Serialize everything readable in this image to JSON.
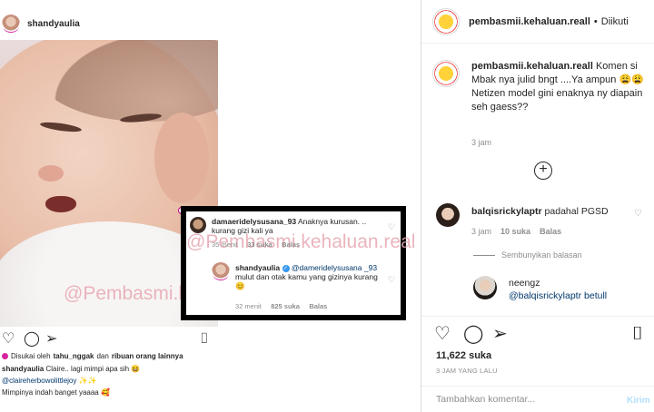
{
  "post_screenshot": {
    "username": "shandyaulia",
    "watermark": "@Pembasmi.kehaluan.real",
    "liked_by_prefix": "Disukai oleh",
    "liked_by_user": "tahu_nggak",
    "liked_by_suffix": "dan",
    "liked_by_others": "ribuan orang lainnya",
    "caption_user": "shandyaulia",
    "caption_text": "Claire.. lagi mimpi apa sih 😆",
    "caption_mention": "@claireherbowolittlejoy",
    "caption_mention_suffix": "✨✨",
    "caption_line3": "Mimpinya indah banget yaaaa 🥰"
  },
  "comment_overlay": {
    "comment1_user": "damaeridelysusana_93",
    "comment1_text": "Anaknya kurusan. .. kurang gizi  kali ya",
    "comment1_time": "35 menit",
    "comment1_likes": "33 suka",
    "comment1_reply": "Balas",
    "reply_user": "shandyaulia",
    "reply_mention": "@dameridelysusana _93",
    "reply_text": "mulut dan otak kamu yang gizinya kurang 😊",
    "reply_time": "32 menit",
    "reply_likes": "825 suka",
    "reply_reply": "Balas"
  },
  "right_panel": {
    "header_user": "pembasmii.kehaluan.reall",
    "header_dot": "•",
    "header_follow": "Diikuti",
    "caption_user": "pembasmii.kehaluan.reall",
    "caption_text_1": "Komen si Mbak nya julid bngt ....Ya ampun 😩😩",
    "caption_text_2": "Netizen model gini enaknya ny diapain seh gaess??",
    "caption_time": "3 jam",
    "comment1_user": "balqisrickylaptr",
    "comment1_text": "padahal PGSD",
    "comment1_time": "3 jam",
    "comment1_likes": "10 suka",
    "comment1_reply": "Balas",
    "hide_replies": "Sembunyikan balasan",
    "reply_user": "neengz",
    "reply_text": "@balqisrickylaptr betull",
    "likes": "11,622 suka",
    "post_time": "3 JAM YANG LALU",
    "comment_placeholder": "Tambahkan komentar...",
    "send_label": "Kirim"
  },
  "icons": [
    "heart-icon",
    "comment-icon",
    "share-icon",
    "bookmark-icon",
    "add-circle-icon",
    "verified-icon"
  ]
}
